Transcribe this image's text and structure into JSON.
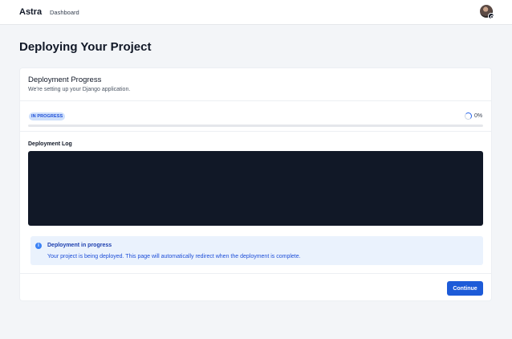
{
  "header": {
    "brand": "Astra",
    "nav_dashboard": "Dashboard",
    "avatar": "user-avatar"
  },
  "page": {
    "title": "Deploying Your Project"
  },
  "progress_card": {
    "title": "Deployment Progress",
    "subtitle": "We're setting up your Django application.",
    "status_badge": "IN PROGRESS",
    "percent_text": "0%",
    "progress_value": 0
  },
  "log": {
    "label": "Deployment Log",
    "content": ""
  },
  "alert": {
    "icon": "info-icon",
    "title": "Deployment in progress",
    "message": "Your project is being deployed. This page will automatically redirect when the deployment is complete."
  },
  "actions": {
    "continue_label": "Continue"
  },
  "colors": {
    "accent": "#2563eb",
    "badge_bg": "#cfe0fb",
    "log_bg": "#111827",
    "alert_bg": "#eaf2fd"
  }
}
